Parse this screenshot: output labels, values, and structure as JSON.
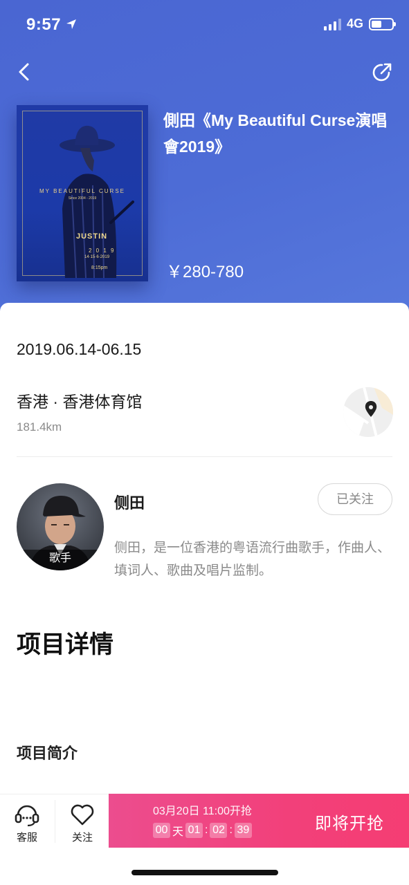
{
  "status_bar": {
    "time": "9:57",
    "network": "4G"
  },
  "header": {
    "back_icon": "chevron-left-icon",
    "share_icon": "share-icon"
  },
  "event": {
    "title": "側田《My Beautiful Curse演唱會2019》",
    "price": "￥280-780",
    "poster": {
      "tagline": "MY BEAUTIFUL CURSE",
      "subline": "Since 2004 - 2019",
      "artist": "JUSTIN",
      "year": "2 0 1 9",
      "dates": "14·15·6·2019",
      "time": "8:15pm"
    },
    "date": "2019.06.14-06.15",
    "venue": "香港 · 香港体育馆",
    "distance": "181.4km"
  },
  "artist": {
    "name": "侧田",
    "role_tag": "歌手",
    "follow_label": "已关注",
    "description": "侧田，是一位香港的粤语流行曲歌手，作曲人、填词人、歌曲及唱片监制。"
  },
  "sections": {
    "details_title": "项目详情",
    "intro_title": "项目简介"
  },
  "bottom_bar": {
    "service_label": "客服",
    "follow_label": "关注",
    "sale_start": "03月20日 11:00开抢",
    "countdown": {
      "days": "00",
      "days_unit": "天",
      "hours": "01",
      "minutes": "02",
      "seconds": "39",
      "sep": ":"
    },
    "cta_label": "即将开抢"
  },
  "colors": {
    "header_blue": "#4d6cd6",
    "cta_pink": "#f2407a",
    "muted_text": "#8a8a8a"
  }
}
